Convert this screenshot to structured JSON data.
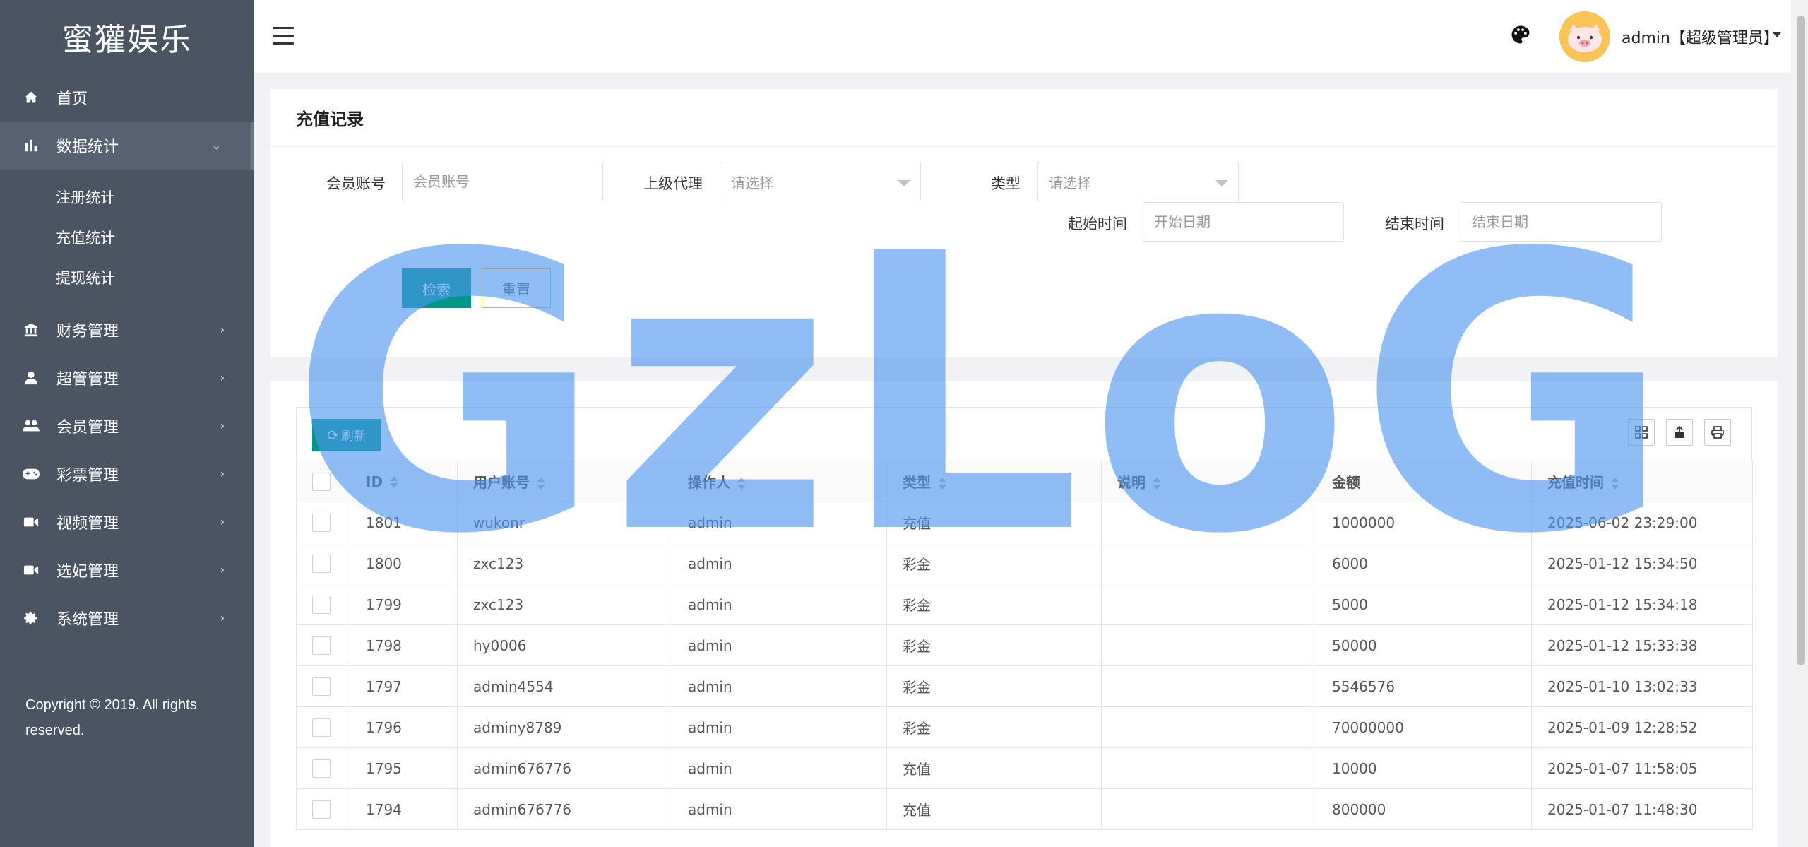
{
  "brand": "蜜獾娱乐",
  "sidebar": {
    "items": [
      {
        "label": "首页",
        "icon": "home-icon"
      },
      {
        "label": "数据统计",
        "icon": "bar-chart-icon",
        "expanded": true,
        "children": [
          {
            "label": "注册统计"
          },
          {
            "label": "充值统计"
          },
          {
            "label": "提现统计"
          }
        ]
      },
      {
        "label": "财务管理",
        "icon": "bank-icon"
      },
      {
        "label": "超管管理",
        "icon": "user-icon"
      },
      {
        "label": "会员管理",
        "icon": "users-icon"
      },
      {
        "label": "彩票管理",
        "icon": "gamepad-icon"
      },
      {
        "label": "视频管理",
        "icon": "video-icon"
      },
      {
        "label": "选妃管理",
        "icon": "video-icon"
      },
      {
        "label": "系统管理",
        "icon": "gear-icon"
      }
    ],
    "copyright": "Copyright © 2019. All rights reserved."
  },
  "header": {
    "user": "admin【超级管理员】"
  },
  "filter": {
    "title": "充值记录",
    "member_label": "会员账号",
    "member_placeholder": "会员账号",
    "agent_label": "上级代理",
    "agent_value": "请选择",
    "type_label": "类型",
    "type_value": "请选择",
    "start_label": "起始时间",
    "start_placeholder": "开始日期",
    "end_label": "结束时间",
    "end_placeholder": "结束日期",
    "search_label": "检索",
    "reset_label": "重置"
  },
  "table": {
    "refresh_label": "刷新",
    "columns": [
      "ID",
      "用户账号",
      "操作人",
      "类型",
      "说明",
      "金额",
      "充值时间"
    ],
    "rows": [
      {
        "id": "1801",
        "account": "wukonr",
        "operator": "admin",
        "type": "充值",
        "kind": "recharge",
        "desc": "",
        "amount": "1000000",
        "time": "2025-06-02 23:29:00"
      },
      {
        "id": "1800",
        "account": "zxc123",
        "operator": "admin",
        "type": "彩金",
        "kind": "bonus",
        "desc": "",
        "amount": "6000",
        "time": "2025-01-12 15:34:50"
      },
      {
        "id": "1799",
        "account": "zxc123",
        "operator": "admin",
        "type": "彩金",
        "kind": "bonus",
        "desc": "",
        "amount": "5000",
        "time": "2025-01-12 15:34:18"
      },
      {
        "id": "1798",
        "account": "hy0006",
        "operator": "admin",
        "type": "彩金",
        "kind": "bonus",
        "desc": "",
        "amount": "50000",
        "time": "2025-01-12 15:33:38"
      },
      {
        "id": "1797",
        "account": "admin4554",
        "operator": "admin",
        "type": "彩金",
        "kind": "bonus",
        "desc": "",
        "amount": "5546576",
        "time": "2025-01-10 13:02:33"
      },
      {
        "id": "1796",
        "account": "adminy8789",
        "operator": "admin",
        "type": "彩金",
        "kind": "bonus",
        "desc": "",
        "amount": "70000000",
        "time": "2025-01-09 12:28:52"
      },
      {
        "id": "1795",
        "account": "admin676776",
        "operator": "admin",
        "type": "充值",
        "kind": "recharge",
        "desc": "",
        "amount": "10000",
        "time": "2025-01-07 11:58:05"
      },
      {
        "id": "1794",
        "account": "admin676776",
        "operator": "admin",
        "type": "充值",
        "kind": "recharge",
        "desc": "",
        "amount": "800000",
        "time": "2025-01-07 11:48:30"
      }
    ]
  },
  "watermark": "GzLoG",
  "colors": {
    "sidebar": "#4a5463",
    "primary": "#009688",
    "warn": "#ffb800",
    "recharge": "#1a8f1a",
    "bonus": "#f5c400"
  }
}
